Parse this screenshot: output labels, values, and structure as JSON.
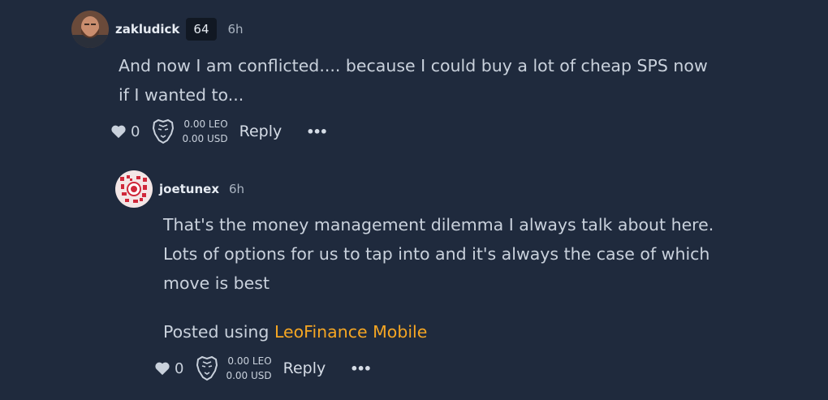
{
  "comment1": {
    "username": "zakludick",
    "reputation": "64",
    "time": "6h",
    "body_lines": [
      "And now I am conflicted.... because I could buy a lot of cheap SPS now",
      "if I wanted to..."
    ],
    "likes": "0",
    "leo": "0.00 LEO",
    "usd": "0.00 USD",
    "reply_label": "Reply",
    "more_label": "•••"
  },
  "comment2": {
    "username": "joetunex",
    "time": "6h",
    "body_lines": [
      "That's the money management dilemma I always talk about here.",
      "Lots of options for us to tap into and it's always the case of which",
      "move is best"
    ],
    "posted_prefix": "Posted using ",
    "posted_link": "LeoFinance Mobile",
    "likes": "0",
    "leo": "0.00 LEO",
    "usd": "0.00 USD",
    "reply_label": "Reply",
    "more_label": "•••"
  },
  "colors": {
    "background": "#1f2a3d",
    "link": "#f5a623"
  },
  "icons": [
    "heart-icon",
    "leo-lion-icon",
    "more-options-icon"
  ]
}
